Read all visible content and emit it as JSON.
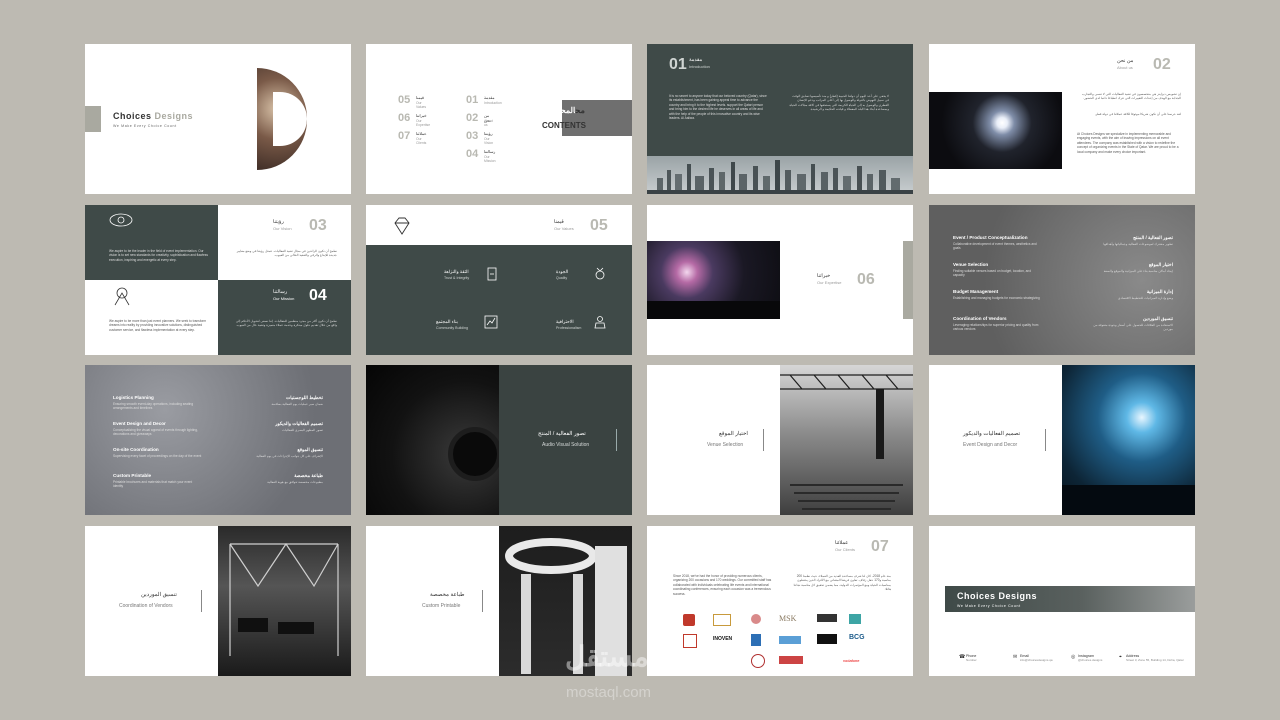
{
  "brand": {
    "name_a": "Choices ",
    "name_b": "Designs",
    "tagline": "We Make Every Choice Count"
  },
  "contents": {
    "ar": "المحتويات",
    "en": "CONTENTS",
    "items": [
      {
        "n": "01",
        "ar": "مقدمة",
        "en": "Introduction"
      },
      {
        "n": "02",
        "ar": "من نحن",
        "en": "About us"
      },
      {
        "n": "03",
        "ar": "رؤيتنا",
        "en": "Our Vision"
      },
      {
        "n": "04",
        "ar": "رسالتنا",
        "en": "Our Mission"
      },
      {
        "n": "05",
        "ar": "قيمنا",
        "en": "Our Values"
      },
      {
        "n": "06",
        "ar": "خبراتنا",
        "en": "Our Expertise"
      },
      {
        "n": "07",
        "ar": "عملائنا",
        "en": "Our Clients"
      }
    ]
  },
  "intro": {
    "num": "01",
    "ar": "مقدمة",
    "en": "Introduction",
    "text_en": "It is no secret to anyone today that our beloved country (Qatar), since its establishment, has been gaining appeal time to advance the country and bring it to the highest levels. support the Qatari person and bring him to the desired life he deserves in all areas of life and with the help of the people of this innovative country and its wise leaders. Al Aaliwa.",
    "text_ar": "لا يخفى على أحد اليوم أن دولتنا الحبيبة (قطر) و منذ تأسيسها تسابق الوقت في سبيل النهوض بالدولة والوصول بها إلى أعلى المراتب ودعم الإنسان القطري والوصول به إلى الحياة الكريمة التي يستحقها في كافة مجالات الحياة وبمساعدة أبناء هذا البلد المعطاء و قيادته الحكيمة و الرشيدة."
  },
  "about": {
    "num": "02",
    "ar": "من نحن",
    "en": "About us",
    "text_ar1": "إن تشويس ديزاينز هي متخصصون في تنفيذ الفعاليات التي لا تنسى والتجارب الجذابة مع الهدف من إحداث التغييرات التي تترك انطباعا دائما لدى الحضور.",
    "text_ar2": "لقد حرصنا على أن نكون شريكا موثوقا لكافة عملائنا في دولة قطر.",
    "text_en": "At Choices Designs we specialize in implementing memorable and engaging events, with the aim of leaving impressions on all event attendees. The company was established with a vision to redefine the concept of organizing events in the State of Qatar. We are proud to be a local company and make every choice important."
  },
  "vision": {
    "num": "03",
    "ar": "رؤيتنا",
    "en": "Our Vision",
    "text_en": "We aspire to be the leader in the field of event implementation. Our vision is to set new standards for creativity, sophistication and flawless execution, inspiring and energetic at every step.",
    "text_ar": "نطمح أن نكون الرائدين في مجال تنفيذ الفعاليات. تتمثل رؤيتنا في وضع معايير جديدة للإبداع والرقي والتنفيذ الخالي من العيوب."
  },
  "mission": {
    "num": "04",
    "ar": "رسالتنا",
    "en": "Our Mission",
    "text_en": "We aspire to be more than just event planners. We seek to transform dreams into reality by providing innovative solutions, distinguished customer service, and flawless implementation at every step.",
    "text_ar": "نطمح أن نكون أكثر من مجرد منظمين للفعاليات. إننا نسعى لتحويل الأحلام إلى واقع من خلال تقديم حلول مبتكرة وخدمة عملاء متميزة وتنفيذ خال من العيوب."
  },
  "values": {
    "num": "05",
    "ar": "قيمنا",
    "en": "Our Values",
    "items": [
      {
        "ar": "الجودة",
        "en": "Quality"
      },
      {
        "ar": "الثقة والنزاهة",
        "en": "Trust & Integrity"
      },
      {
        "ar": "الاحترافية",
        "en": "Professionalism"
      },
      {
        "ar": "بناء المجتمع",
        "en": "Community Building"
      }
    ]
  },
  "expertise": {
    "num": "06",
    "ar": "خبراتنا",
    "en": "Our Expertise"
  },
  "services1": [
    {
      "en": "Event / Product Conceptualization",
      "en_d": "Collaborative development of event themes, aesthetics and goals",
      "ar": "تصور الفعالية / المنتج",
      "ar_d": "تطوير مشترك لموضوعات الفعالية وجمالياتها وأهدافها"
    },
    {
      "en": "Venue Selection",
      "en_d": "Finding suitable venues based on budget, location, and capacity",
      "ar": "اختيار الموقع",
      "ar_d": "إيجاد أماكن مناسبة بناء على الميزانية والموقع والسعة"
    },
    {
      "en": "Budget Management",
      "en_d": "Establishing and managing budgets for economic strategizing",
      "ar": "إدارة الميزانية",
      "ar_d": "وضع وإدارة الميزانيات للتخطيط الاقتصادي"
    },
    {
      "en": "Coordination of Vendors",
      "en_d": "Leveraging relationships for superior pricing and quality from various vendors",
      "ar": "تنسيق الموردين",
      "ar_d": "الاستفادة من العلاقات للحصول على أسعار وجودة متفوقة من موردين"
    }
  ],
  "services2": [
    {
      "en": "Logistics Planning",
      "en_d": "Ensuring smooth event-day operations, including seating arrangements and timelines",
      "ar": "تخطيط اللوجستيات",
      "ar_d": "ضمان سير عمليات يوم الفعالية بسلاسة"
    },
    {
      "en": "Event Design and Decor",
      "en_d": "Conceptualizing the visual appeal of events through lighting, decorations and giveaways",
      "ar": "تصميم الفعاليات والديكور",
      "ar_d": "تصور المظهر البصري للفعاليات"
    },
    {
      "en": "On-site Coordination",
      "en_d": "Supervising every facet of proceedings on the day of the event",
      "ar": "تنسيق الموقع",
      "ar_d": "الإشراف على كل جوانب الإجراءات في يوم الفعالية"
    },
    {
      "en": "Custom Printable",
      "en_d": "Printable brochures and materials that match your event identity",
      "ar": "طباعة مخصصة",
      "ar_d": "مطبوعات مخصصة تتوافق مع هوية الفعالية"
    }
  ],
  "svc_slides": [
    {
      "ar": "تصور الفعالية / المنتج",
      "en": "Audio Visual Solution"
    },
    {
      "ar": "اختيار الموقع",
      "en": "Venue Selection"
    },
    {
      "ar": "تصميم الفعاليات والديكور",
      "en": "Event Design and Decor"
    },
    {
      "ar": "تنسيق الموردين",
      "en": "Coordination of Vendors"
    },
    {
      "ar": "طباعة مخصصة",
      "en": "Custom Printable"
    }
  ],
  "clients": {
    "num": "07",
    "ar": "عملائنا",
    "en": "Our Clients",
    "text_en": "Since 2018, we've had the honor of providing numerous clients, organizing 200 occasions and 170 weddings. Our committed staff has collaborated with individuals celebrating life events and international coordinating conferences, ensuring each occasion was a tremendous success.",
    "text_ar": "منذ عام 2018، كان لنا شرف مساعدة العديد من العملاء، حيث نظمنا 200 مناسبة و170 حفل زفاف. تعاون فريقنا المتفاني مع الأفراد الذين يحتفلون بمناسبات الحياة ومع المؤتمرات الدولية، مما يضمن تحقيق كل مناسبة نجاحا هائلا.",
    "logos": [
      "MSK",
      "INOVEN",
      "BCG",
      "vodafone"
    ]
  },
  "contact": [
    {
      "label": "Phone",
      "value": "Number"
    },
    {
      "label": "Email",
      "value": "info@choicesdesigns.qa"
    },
    {
      "label": "Instagram",
      "value": "@choices.designs"
    },
    {
      "label": "Address",
      "value": "Street 3, Zone 55, Building 14, Doha, Qatar"
    }
  ],
  "watermark": {
    "ar": "مستقل",
    "en": "mostaql.com"
  },
  "colors": {
    "bg": "#bdbab2",
    "dark": "#3f4a48",
    "grey": "#6f6f6f",
    "accent": "#a9a9a0"
  }
}
